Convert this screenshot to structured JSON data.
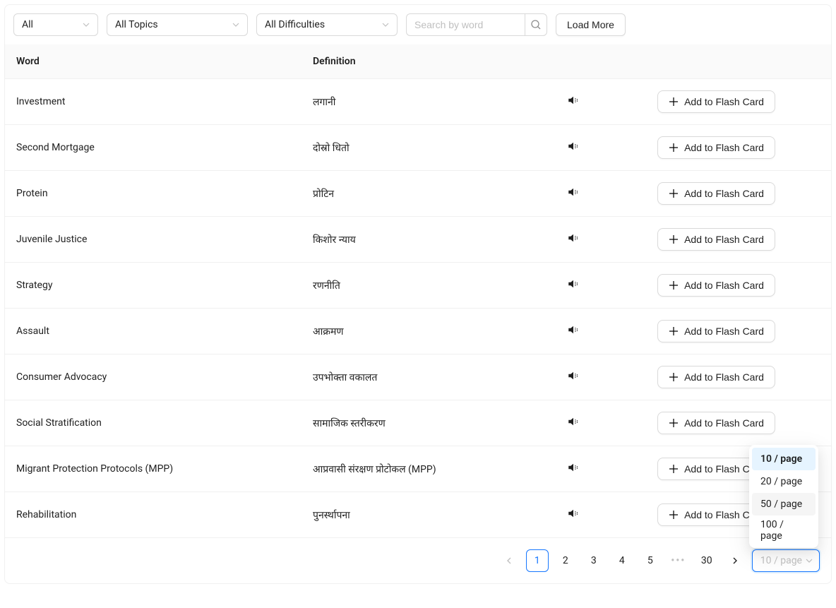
{
  "filters": {
    "category": "All",
    "topic": "All Topics",
    "difficulty": "All Difficulties"
  },
  "search": {
    "placeholder": "Search by word",
    "value": ""
  },
  "buttons": {
    "load_more": "Load More",
    "add_flash": "Add to Flash Card"
  },
  "columns": {
    "word": "Word",
    "definition": "Definition"
  },
  "rows": [
    {
      "word": "Investment",
      "definition": "लगानी"
    },
    {
      "word": "Second Mortgage",
      "definition": "दोस्रो धितो"
    },
    {
      "word": "Protein",
      "definition": "प्रोटिन"
    },
    {
      "word": "Juvenile Justice",
      "definition": "किशोर न्याय"
    },
    {
      "word": "Strategy",
      "definition": "रणनीति"
    },
    {
      "word": "Assault",
      "definition": "आक्रमण"
    },
    {
      "word": "Consumer Advocacy",
      "definition": "उपभोक्ता वकालत"
    },
    {
      "word": "Social Stratification",
      "definition": "सामाजिक स्तरीकरण"
    },
    {
      "word": "Migrant Protection Protocols (MPP)",
      "definition": "आप्रवासी संरक्षण प्रोटोकल (MPP)"
    },
    {
      "word": "Rehabilitation",
      "definition": "पुनर्स्थापना"
    }
  ],
  "pagination": {
    "pages": [
      "1",
      "2",
      "3",
      "4",
      "5"
    ],
    "ellipsis": "•••",
    "last": "30",
    "size_label": "10 / page",
    "options": [
      "10 / page",
      "20 / page",
      "50 / page",
      "100 / page"
    ],
    "active": "1"
  }
}
